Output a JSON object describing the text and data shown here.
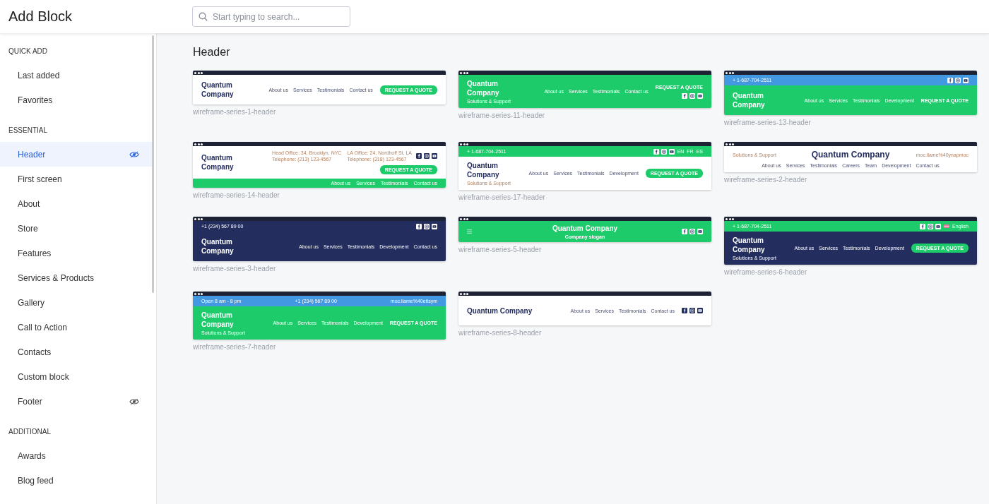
{
  "app_bar": {
    "title": "Add Block",
    "search": {
      "placeholder": "Start typing to search..."
    }
  },
  "sidebar": {
    "sections": [
      {
        "title": "QUICK ADD",
        "items": [
          {
            "label": "Last added",
            "selected": false,
            "has_toggle": false
          },
          {
            "label": "Favorites",
            "selected": false,
            "has_toggle": false
          }
        ]
      },
      {
        "title": "ESSENTIAL",
        "items": [
          {
            "label": "Header",
            "selected": true,
            "has_toggle": true
          },
          {
            "label": "First screen",
            "selected": false,
            "has_toggle": false
          },
          {
            "label": "About",
            "selected": false,
            "has_toggle": false
          },
          {
            "label": "Store",
            "selected": false,
            "has_toggle": false
          },
          {
            "label": "Features",
            "selected": false,
            "has_toggle": false
          },
          {
            "label": "Services & Products",
            "selected": false,
            "has_toggle": false
          },
          {
            "label": "Gallery",
            "selected": false,
            "has_toggle": false
          },
          {
            "label": "Call to Action",
            "selected": false,
            "has_toggle": false
          },
          {
            "label": "Contacts",
            "selected": false,
            "has_toggle": false
          },
          {
            "label": "Custom block",
            "selected": false,
            "has_toggle": false
          },
          {
            "label": "Footer",
            "selected": false,
            "has_toggle": true
          }
        ]
      },
      {
        "title": "ADDITIONAL",
        "items": [
          {
            "label": "Awards",
            "selected": false,
            "has_toggle": false
          },
          {
            "label": "Blog feed",
            "selected": false,
            "has_toggle": false
          }
        ]
      }
    ]
  },
  "content": {
    "title": "Header",
    "blocks": [
      {
        "caption": "wireframe-series-1-header",
        "kind": "split",
        "color": "#ffffff",
        "logo": "Quantum Company",
        "logo_stacked": true,
        "nav": [
          "About us",
          "Services",
          "Testimonials",
          "Contact us"
        ],
        "button": {
          "label": "REQUEST A QUOTE",
          "kind": "pill"
        }
      },
      {
        "caption": "wireframe-series-11-header",
        "kind": "split",
        "color": "#1ecb6b",
        "logo": "Quantum Company",
        "logo_stacked": true,
        "tagline": "Solutions & Support",
        "nav": [
          "About us",
          "Services",
          "Testimonials",
          "Contact us"
        ],
        "button": {
          "label": "REQUEST A QUOTE",
          "kind": "text"
        },
        "social": true
      },
      {
        "caption": "wireframe-series-13-header",
        "kind": "split",
        "color": "#1ecb6b",
        "top_bar": {
          "color": "#4299e1",
          "texts": [
            "+ 1-687-704-2511"
          ],
          "social": true
        },
        "logo": "Quantum Company",
        "logo_stacked": true,
        "nav": [
          "About us",
          "Services",
          "Testimonials",
          "Development"
        ],
        "button": {
          "label": "REQUEST A QUOTE",
          "kind": "text"
        }
      },
      {
        "caption": "wireframe-series-14-header",
        "kind": "split",
        "color": "#ffffff",
        "logo": "Quantum Company",
        "logo_stacked": true,
        "contacts": [
          "Head Office: 34, Brooklyn, NYC",
          "Telephone: (213) 123-4567",
          "LA Office: 24, Nordhoff St, LA",
          "Telephone: (318) 123-4567"
        ],
        "social": true,
        "button": {
          "label": "REQUEST A QUOTE",
          "kind": "pill"
        },
        "bottom_nav": [
          "About us",
          "Services",
          "Testimonials",
          "Contact us"
        ]
      },
      {
        "caption": "wireframe-series-17-header",
        "kind": "split",
        "color": "#ffffff",
        "top_bar": {
          "color": "#1ecb6b",
          "texts": [
            "+ 1-687-704-2511"
          ],
          "social": true,
          "languages": [
            "EN",
            "FR",
            "ES"
          ]
        },
        "logo": "Quantum Company",
        "logo_stacked": true,
        "tagline": "Solutions & Support",
        "nav": [
          "About us",
          "Services",
          "Testimonials",
          "Development"
        ],
        "button": {
          "label": "REQUEST A QUOTE",
          "kind": "pill"
        }
      },
      {
        "caption": "wireframe-series-2-header",
        "kind": "centered",
        "color": "#ffffff",
        "logo": "Quantum Company",
        "logo_stacked": false,
        "tagline": "Solutions & Support",
        "email": "moc.liame%40ynapmoc",
        "nav": [
          "About us",
          "Services",
          "Testimonials",
          "Careers",
          "Team",
          "Development",
          "Contact us"
        ]
      },
      {
        "caption": "wireframe-series-3-header",
        "kind": "split",
        "color": "#232e5e",
        "top_bar": {
          "color": "#232e5e",
          "texts": [
            "+1 (234) 567 89 00"
          ],
          "social": true
        },
        "logo": "Quantum Company",
        "logo_stacked": true,
        "nav": [
          "About us",
          "Services",
          "Testimonials",
          "Development",
          "Contact us"
        ]
      },
      {
        "caption": "wireframe-series-5-header",
        "kind": "center-logo",
        "color": "#1ecb6b",
        "logo": "Quantum Company",
        "logo_stacked": false,
        "tagline": "Company slogan",
        "social": true
      },
      {
        "caption": "wireframe-series-6-header",
        "kind": "split",
        "color": "#232e5e",
        "top_bar": {
          "color": "#1ecb6b",
          "texts": [
            "+ 1-687-704-2511"
          ],
          "social": true,
          "language_flag": true,
          "languages": [
            "English"
          ]
        },
        "logo": "Quantum Company",
        "logo_stacked": true,
        "tagline": "Solutions & Support",
        "nav": [
          "About us",
          "Services",
          "Testimonials",
          "Development"
        ],
        "button": {
          "label": "REQUEST A QUOTE",
          "kind": "pill"
        }
      },
      {
        "caption": "wireframe-series-7-header",
        "kind": "split",
        "color": "#1ecb6b",
        "top_bar": {
          "color": "#4299e1",
          "texts": [
            "Open 8 am - 8 pm",
            "+1 (234) 567 89 00",
            "moc.liame%40etisym"
          ]
        },
        "logo": "Quantum Company",
        "logo_stacked": true,
        "tagline": "Solutions & Support",
        "nav": [
          "About us",
          "Services",
          "Testimonials",
          "Development"
        ],
        "button": {
          "label": "REQUEST A QUOTE",
          "kind": "text"
        }
      },
      {
        "caption": "wireframe-series-8-header",
        "kind": "split",
        "color": "#ffffff",
        "logo": "Quantum Company",
        "logo_stacked": false,
        "nav": [
          "About us",
          "Services",
          "Testimonials",
          "Contact us"
        ],
        "social": true
      }
    ]
  }
}
